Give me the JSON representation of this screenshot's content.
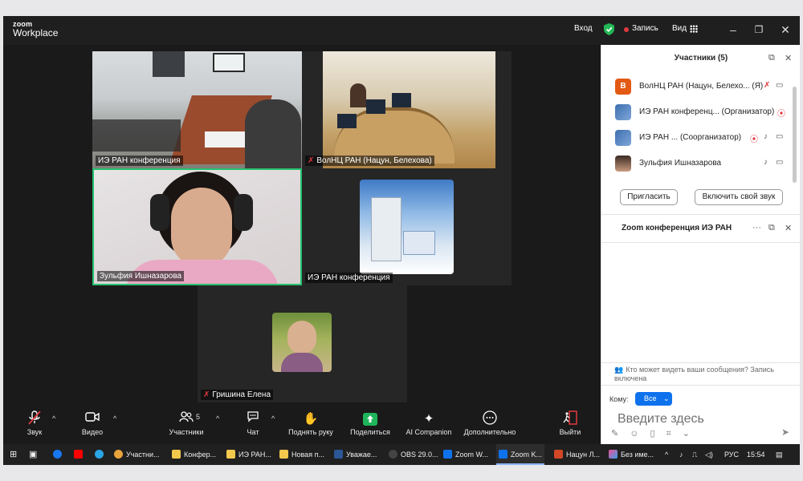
{
  "app": {
    "logo_line1": "zoom",
    "logo_line2": "Workplace"
  },
  "topbar": {
    "login": "Вход",
    "recording": "Запись",
    "view": "Вид"
  },
  "tiles": [
    {
      "name": "ИЭ РАН конференция"
    },
    {
      "name": "ВолНЦ РАН (Нацун, Белехова)"
    },
    {
      "name": "Зульфия Ишназарова"
    },
    {
      "name": "ИЭ РАН конференция"
    },
    {
      "name": "Гришина Елена"
    }
  ],
  "toolbar": {
    "audio": "Звук",
    "video": "Видео",
    "participants": "Участники",
    "participants_count": "5",
    "chat": "Чат",
    "raise_hand": "Поднять руку",
    "share": "Поделиться",
    "ai": "AI Companion",
    "more": "Дополнительно",
    "leave": "Выйти"
  },
  "panel": {
    "participants_title": "Участники (5)",
    "participants": [
      {
        "avatar": "В",
        "name": "ВолНЦ РАН (Нацун, Белехо... (Я)"
      },
      {
        "name": "ИЭ РАН конференц... (Организатор)"
      },
      {
        "name": "ИЭ РАН ...  (Соорганизатор)"
      },
      {
        "name": "Зульфия Ишназарова"
      }
    ],
    "invite_button": "Пригласить",
    "unmute_button": "Включить свой звук",
    "chat_title": "Zoom конференция ИЭ РАН",
    "chat_info": "Кто может видеть ваши сообщения? Запись включена",
    "to_label": "Кому:",
    "to_value": "Все",
    "input_placeholder": "Введите здесь"
  },
  "taskbar": {
    "items": [
      "Участни...",
      "Конфер...",
      "ИЭ РАН...",
      "Новая п...",
      "Уважае...",
      "OBS 29.0...",
      "Zoom W...",
      "Zoom K...",
      "Нацун Л...",
      "Без имe..."
    ],
    "lang": "РУС",
    "time": "15:54"
  },
  "colors": {
    "accent_blue": "#0e72ed",
    "record_red": "#e0393e",
    "share_green": "#1fb55a",
    "active_speaker": "#25c16f"
  }
}
